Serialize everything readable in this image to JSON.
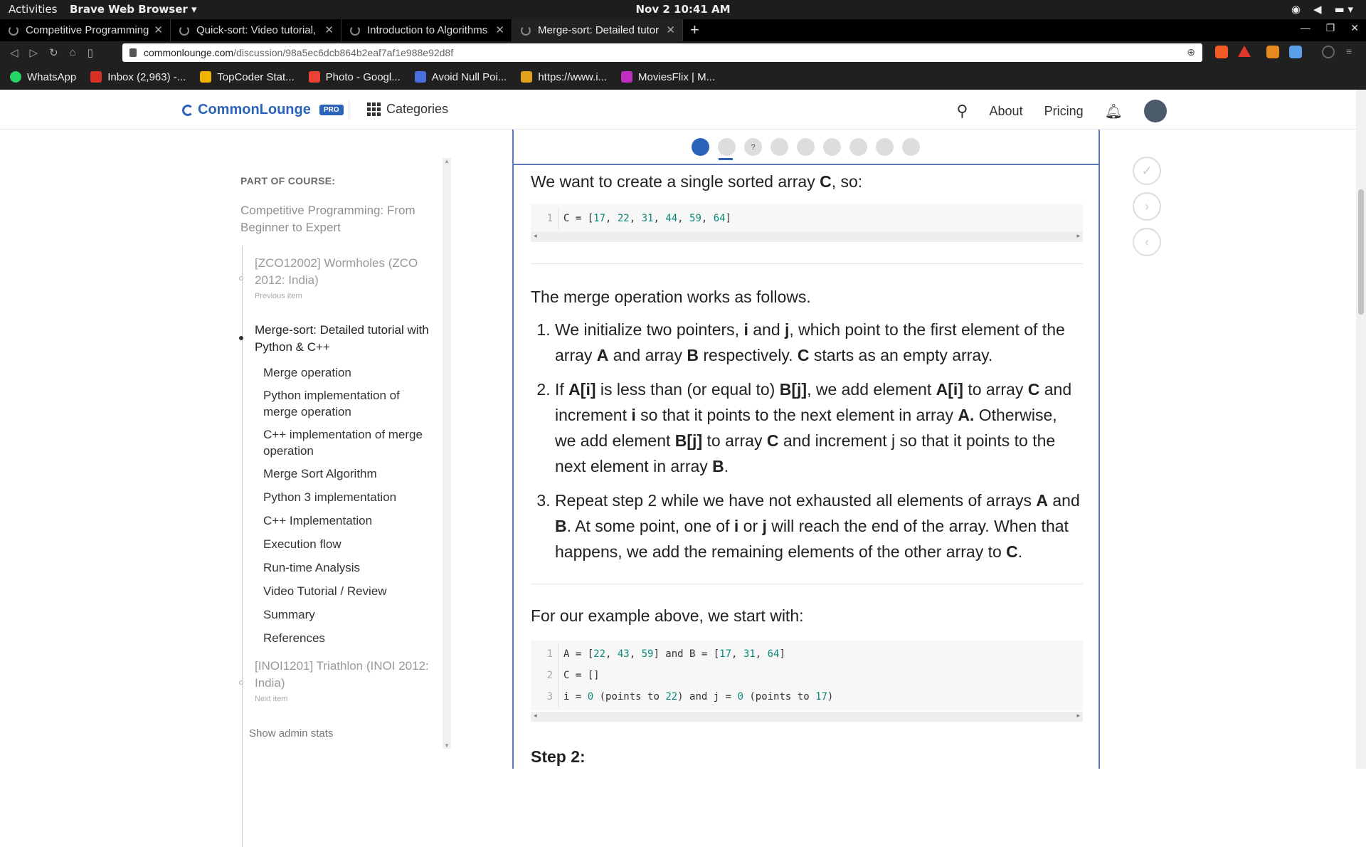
{
  "os": {
    "activities": "Activities",
    "app_name": "Brave Web Browser ▾",
    "clock": "Nov 2  10:41 AM"
  },
  "tabs": [
    {
      "title": "Competitive Programming"
    },
    {
      "title": "Quick-sort: Video tutorial, "
    },
    {
      "title": "Introduction to Algorithms"
    },
    {
      "title": "Merge-sort: Detailed tutor"
    }
  ],
  "address": {
    "domain": "commonlounge.com",
    "path": "/discussion/98a5ec6dcb864b2eaf7af1e988e92d8f"
  },
  "bookmarks": [
    {
      "label": "WhatsApp",
      "color": "#25d366"
    },
    {
      "label": "Inbox (2,963) -...",
      "color": "#d93025"
    },
    {
      "label": "TopCoder Stat...",
      "color": "#f0b400"
    },
    {
      "label": "Photo - Googl...",
      "color": "#ea4335"
    },
    {
      "label": "Avoid Null Poi...",
      "color": "#4a6fe0"
    },
    {
      "label": "https://www.i...",
      "color": "#e0a020"
    },
    {
      "label": "MoviesFlix | M...",
      "color": "#c030c0"
    }
  ],
  "header": {
    "logo": "CommonLounge",
    "pro_badge": "PRO",
    "categories": "Categories",
    "about": "About",
    "pricing": "Pricing"
  },
  "sidebar": {
    "part_of_course": "PART OF COURSE:",
    "course_title": "Competitive Programming: From Beginner to Expert",
    "previous_title": "[ZCO12002] Wormholes (ZCO 2012: India)",
    "previous_label": "Previous item",
    "current_title": "Merge-sort: Detailed tutorial with Python & C++",
    "toc": [
      "Merge operation",
      "Python implementation of merge operation",
      "C++ implementation of merge operation",
      "Merge Sort Algorithm",
      "Python 3 implementation",
      "C++ Implementation",
      "Execution flow",
      "Run-time Analysis",
      "Video Tutorial / Review",
      "Summary",
      "References"
    ],
    "next_title": "[INOI1201] Triathlon (INOI 2012: India)",
    "next_label": "Next item",
    "admin_stats": "Show admin stats"
  },
  "pager": {
    "count": 9,
    "active_index": 0,
    "quiz_index": 2,
    "quiz_label": "?"
  },
  "content": {
    "intro_before": "We want to create a single sorted array ",
    "intro_bold": "C",
    "intro_after": ", so:",
    "code1": [
      {
        "line": "1",
        "pre": "C = [",
        "nums": [
          "17",
          "22",
          "31",
          "44",
          "59",
          "64"
        ],
        "post": "]"
      }
    ],
    "merge_intro": "The merge operation works as follows.",
    "steps": [
      "We initialize two pointers, i and j, which point to the first element of the array A and array B respectively. C starts as an empty array.",
      "If A[i] is less than (or equal to) B[j], we add element A[i] to array C and increment i so that it points to the next element in array A. Otherwise, we add element B[j] to array C and increment j so that it points to the next element in array B.",
      "Repeat step 2 while we have not exhausted all elements of arrays A and B. At some point, one of i or j will reach the end of the array. When that happens, we add the remaining elements of the other array to C."
    ],
    "example_intro": "For our example above, we start with:",
    "code2": [
      {
        "line": "1",
        "text": "A = [22, 43, 59] and B = [17, 31, 64]"
      },
      {
        "line": "2",
        "text": "C = []"
      },
      {
        "line": "3",
        "text": "i = 0 (points to 22) and j = 0 (points to 17)"
      }
    ],
    "step2_heading": "Step 2:"
  },
  "colors": {
    "brand": "#2c62b8",
    "code_number": "#0a8a7a",
    "panel_border": "#6079b8"
  }
}
